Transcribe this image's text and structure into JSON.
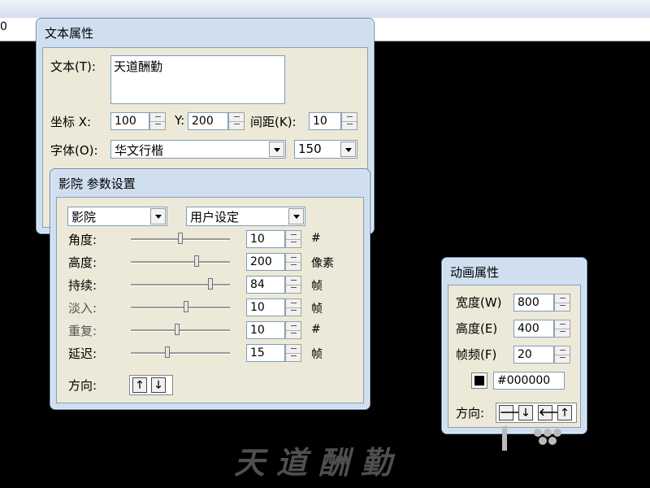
{
  "app": {
    "edit_text": "0"
  },
  "text_panel": {
    "title": "文本属性",
    "text_label": "文本(T):",
    "text_value": "天道酬勤",
    "coord_label": "坐标 X:",
    "x_value": "100",
    "y_label": "Y:",
    "y_value": "200",
    "spacing_label": "间距(K):",
    "spacing_value": "10",
    "font_label": "字体(O):",
    "font_value": "华文行楷",
    "size_value": "150"
  },
  "shadow_panel": {
    "title": "影院 参数设置",
    "preset_value": "影院",
    "mode_value": "用户设定",
    "rows": [
      {
        "label": "角度:",
        "value": "10",
        "unit": "#",
        "level": 0.5,
        "disabled": false
      },
      {
        "label": "高度:",
        "value": "200",
        "unit": "像素",
        "level": 0.66,
        "disabled": false
      },
      {
        "label": "持续:",
        "value": "84",
        "unit": "帧",
        "level": 0.8,
        "disabled": false
      },
      {
        "label": "淡入:",
        "value": "10",
        "unit": "帧",
        "level": 0.56,
        "disabled": true
      },
      {
        "label": "重复:",
        "value": "10",
        "unit": "#",
        "level": 0.47,
        "disabled": true
      },
      {
        "label": "延迟:",
        "value": "15",
        "unit": "帧",
        "level": 0.37,
        "disabled": false
      }
    ],
    "direction_label": "方向:",
    "dir_up": "🡑",
    "dir_down": "🡓"
  },
  "anim_panel": {
    "title": "动画属性",
    "width_label": "宽度(W)",
    "width_value": "800",
    "height_label": "高度(E)",
    "height_value": "400",
    "fps_label": "帧频(F)",
    "fps_value": "20",
    "color_value": "#000000",
    "direction_label": "方向:",
    "dir_right": "🡒",
    "dir_down": "🡓",
    "dir_left": "🡐",
    "dir_up": "🡑"
  },
  "canvas": {
    "brand_text": "天道酬勤"
  },
  "colors": {
    "panel_bg": "#cfdff0",
    "body_bg": "#ece9d8",
    "canvas_bg": "#000000"
  }
}
